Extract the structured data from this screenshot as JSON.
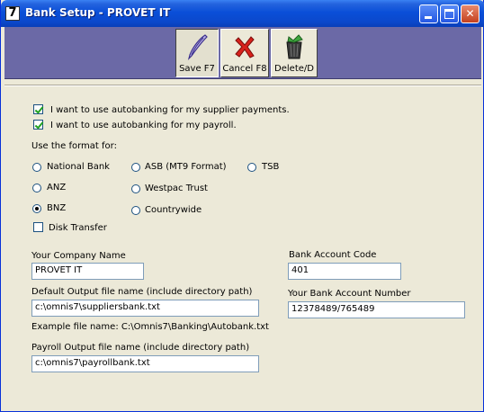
{
  "window": {
    "app_icon_glyph": "7",
    "title": "Bank Setup - PROVET IT"
  },
  "titlebar_buttons": {
    "minimize": "minimize-button",
    "maximize": "maximize-button",
    "close_glyph": "✕"
  },
  "toolbar": {
    "save_label": "Save F7",
    "cancel_label": "Cancel F8",
    "delete_label": "Delete/D"
  },
  "options": {
    "supplier_autobank_label": "I want to use autobanking for my supplier payments.",
    "supplier_autobank_checked": true,
    "payroll_autobank_label": "I want to use autobanking for my payroll.",
    "payroll_autobank_checked": true,
    "format_heading": "Use the format for:"
  },
  "formats": {
    "national_bank": "National Bank",
    "asb": "ASB (MT9 Format)",
    "tsb": "TSB",
    "anz": "ANZ",
    "westpac": "Westpac Trust",
    "bnz": "BNZ",
    "countrywide": "Countrywide",
    "selected": "BNZ",
    "disk_transfer_label": "Disk Transfer",
    "disk_transfer_checked": false
  },
  "form": {
    "company_name_label": "Your Company Name",
    "company_name_value": "PROVET IT",
    "default_output_label": "Default Output file name (include directory path)",
    "default_output_value": "c:\\omnis7\\suppliersbank.txt",
    "example_text": "Example file name: C:\\Omnis7\\Banking\\Autobank.txt",
    "payroll_output_label": "Payroll Output file name (include directory path)",
    "payroll_output_value": "c:\\omnis7\\payrollbank.txt",
    "bank_code_label": "Bank Account Code",
    "bank_code_value": "401",
    "bank_account_label": "Your Bank Account Number",
    "bank_account_value": "12378489/765489"
  },
  "colors": {
    "toolbar_bg": "#6b69a6",
    "window_bg": "#ece9d8",
    "titlebar": "#0a4fd8"
  }
}
